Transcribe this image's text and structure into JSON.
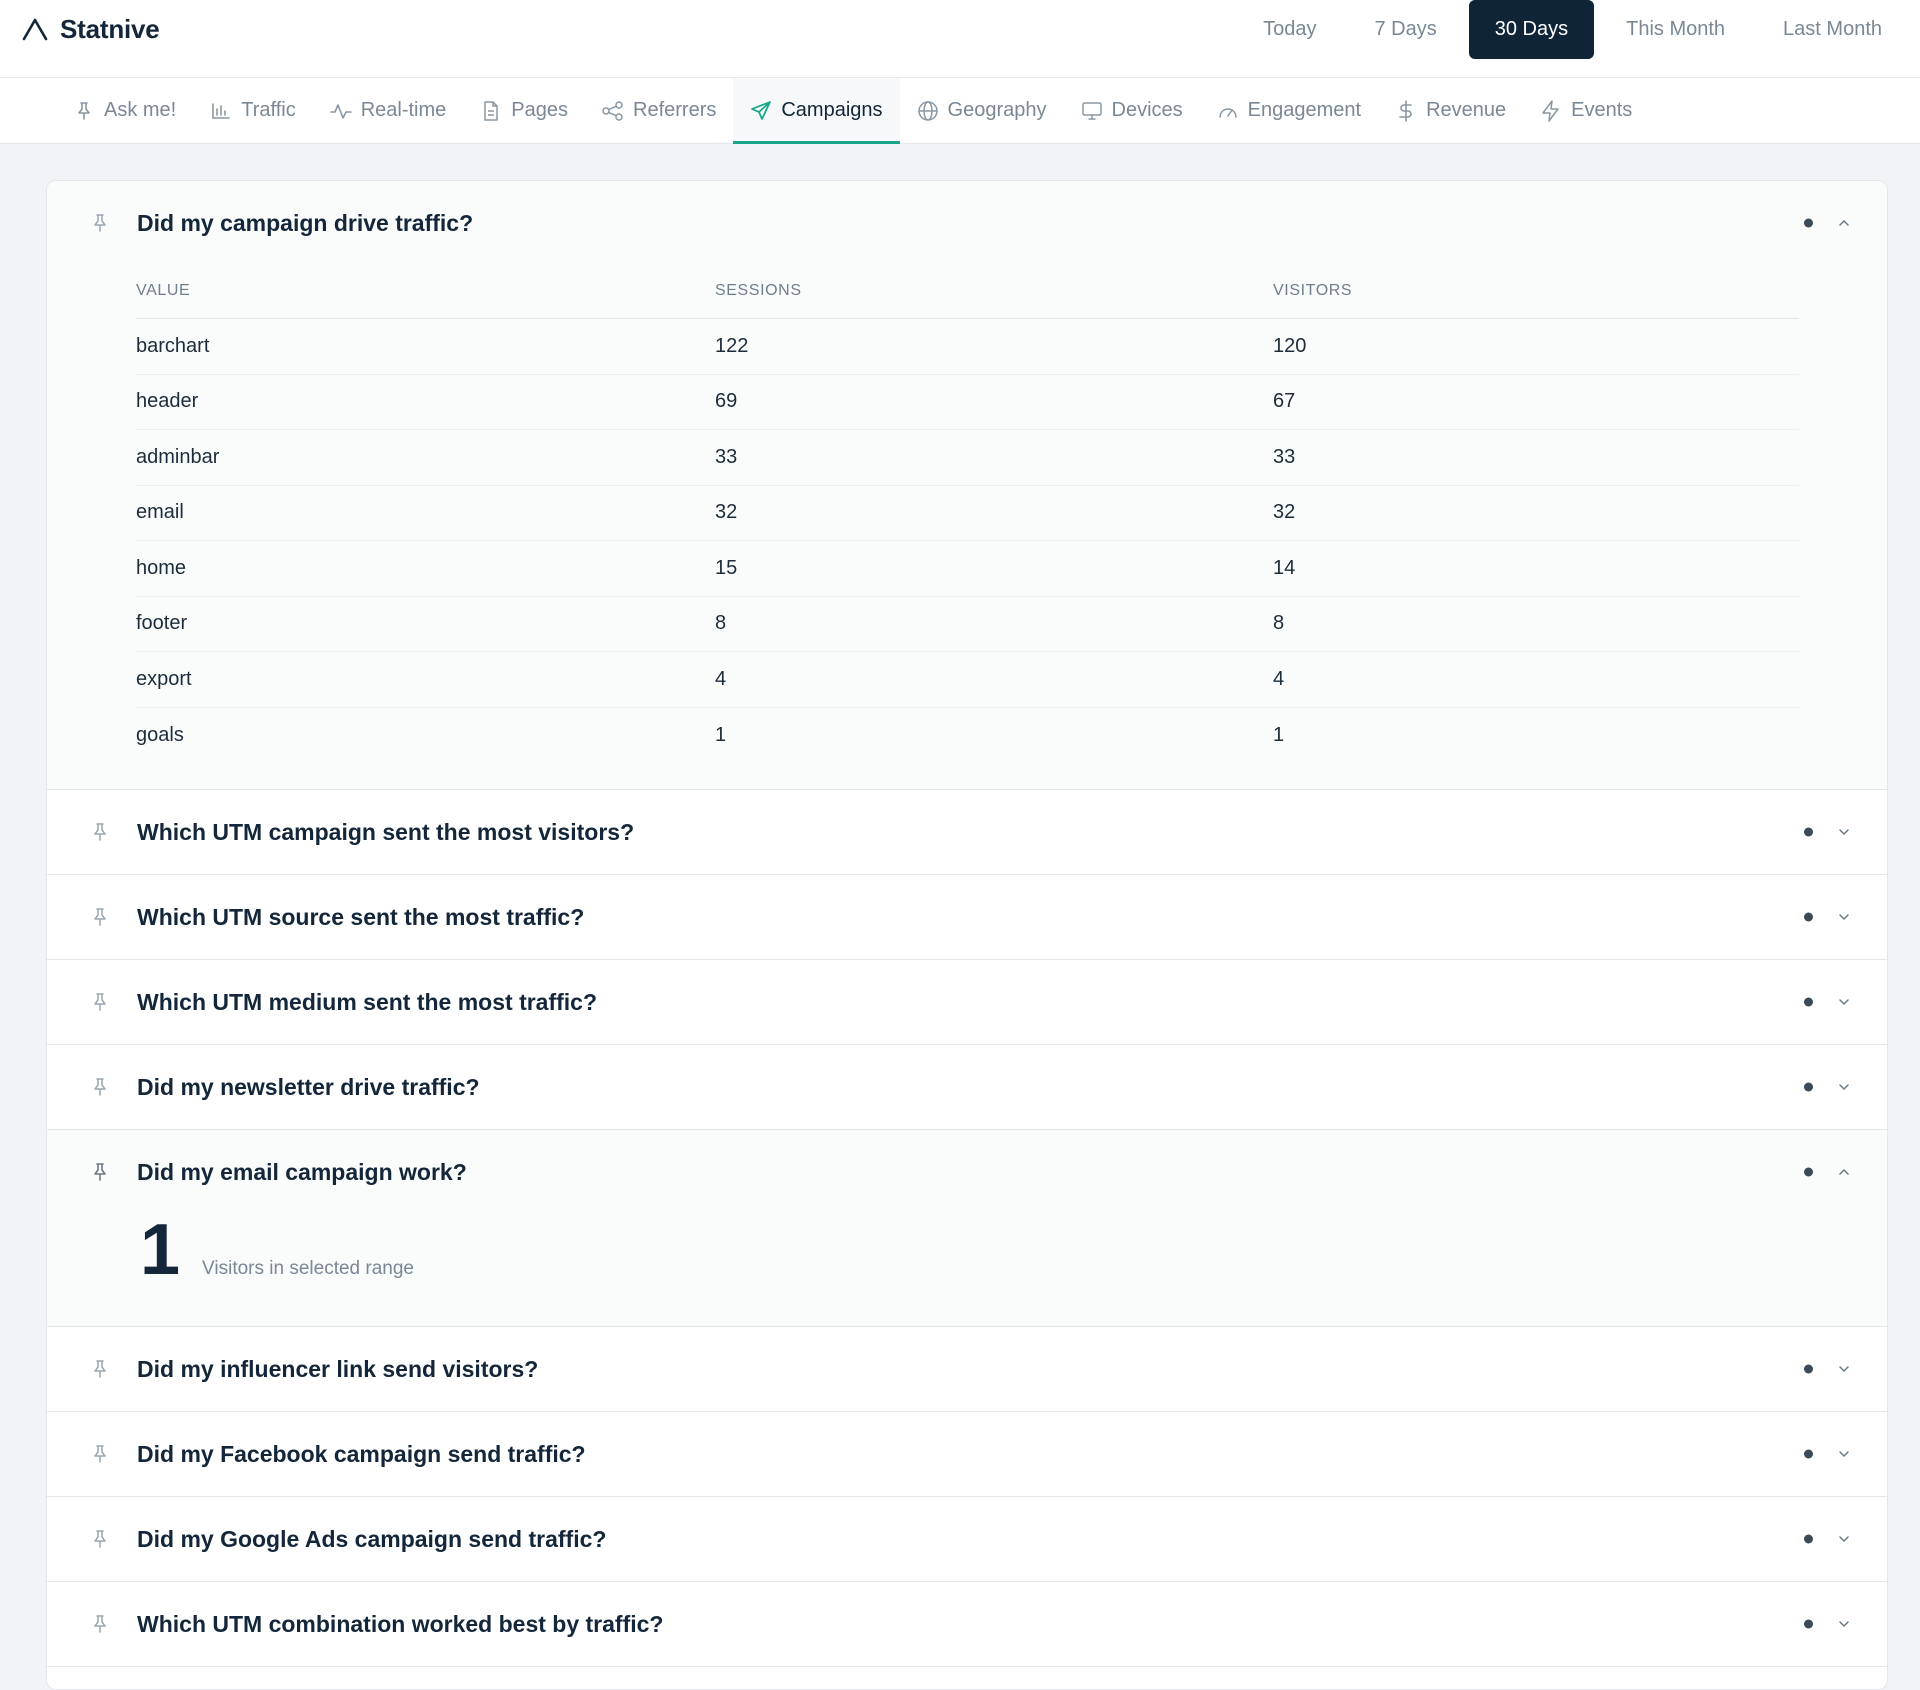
{
  "app": {
    "name": "Statnive"
  },
  "ranges": {
    "items": [
      {
        "label": "Today",
        "active": false
      },
      {
        "label": "7 Days",
        "active": false
      },
      {
        "label": "30 Days",
        "active": true
      },
      {
        "label": "This Month",
        "active": false
      },
      {
        "label": "Last Month",
        "active": false
      }
    ]
  },
  "tabs": {
    "items": [
      {
        "label": "Ask me!",
        "icon": "pin-icon",
        "active": false
      },
      {
        "label": "Traffic",
        "icon": "bar-chart-icon",
        "active": false
      },
      {
        "label": "Real-time",
        "icon": "pulse-icon",
        "active": false
      },
      {
        "label": "Pages",
        "icon": "document-icon",
        "active": false
      },
      {
        "label": "Referrers",
        "icon": "share-icon",
        "active": false
      },
      {
        "label": "Campaigns",
        "icon": "send-icon",
        "active": true
      },
      {
        "label": "Geography",
        "icon": "globe-icon",
        "active": false
      },
      {
        "label": "Devices",
        "icon": "monitor-icon",
        "active": false
      },
      {
        "label": "Engagement",
        "icon": "gauge-icon",
        "active": false
      },
      {
        "label": "Revenue",
        "icon": "dollar-icon",
        "active": false
      },
      {
        "label": "Events",
        "icon": "lightning-icon",
        "active": false
      }
    ]
  },
  "questions": {
    "q0": {
      "title": "Did my campaign drive traffic?",
      "expanded": true,
      "table": {
        "columns": [
          "VALUE",
          "SESSIONS",
          "VISITORS"
        ],
        "rows": [
          [
            "barchart",
            "122",
            "120"
          ],
          [
            "header",
            "69",
            "67"
          ],
          [
            "adminbar",
            "33",
            "33"
          ],
          [
            "email",
            "32",
            "32"
          ],
          [
            "home",
            "15",
            "14"
          ],
          [
            "footer",
            "8",
            "8"
          ],
          [
            "export",
            "4",
            "4"
          ],
          [
            "goals",
            "1",
            "1"
          ]
        ]
      }
    },
    "q1": {
      "title": "Which UTM campaign sent the most visitors?",
      "expanded": false
    },
    "q2": {
      "title": "Which UTM source sent the most traffic?",
      "expanded": false
    },
    "q3": {
      "title": "Which UTM medium sent the most traffic?",
      "expanded": false
    },
    "q4": {
      "title": "Did my newsletter drive traffic?",
      "expanded": false
    },
    "q5": {
      "title": "Did my email campaign work?",
      "expanded": true,
      "metric": {
        "value": "1",
        "label": "Visitors in selected range"
      }
    },
    "q6": {
      "title": "Did my influencer link send visitors?",
      "expanded": false
    },
    "q7": {
      "title": "Did my Facebook campaign send traffic?",
      "expanded": false
    },
    "q8": {
      "title": "Did my Google Ads campaign send traffic?",
      "expanded": false
    },
    "q9": {
      "title": "Which UTM combination worked best by traffic?",
      "expanded": false
    }
  },
  "colors": {
    "accent": "#16a589",
    "active_range_bg": "#0f2437",
    "text_primary": "#13263a",
    "text_muted": "#7a8896"
  }
}
